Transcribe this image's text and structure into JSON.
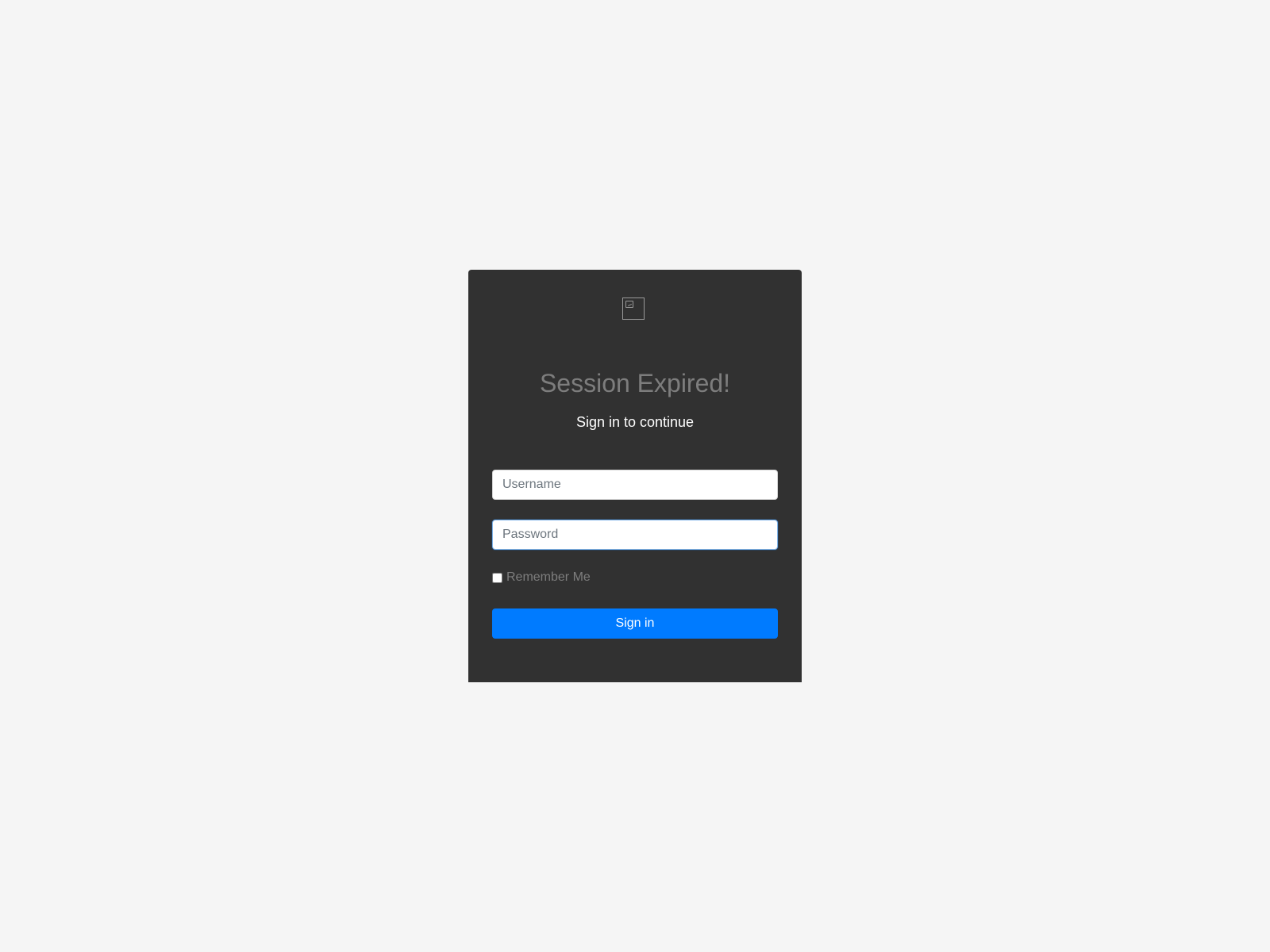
{
  "login": {
    "logo_icon": "broken-image-icon",
    "title": "Session Expired!",
    "subtitle": "Sign in to continue",
    "username_placeholder": "Username",
    "username_value": "",
    "password_placeholder": "Password",
    "password_value": "",
    "remember_me_label": "Remember Me",
    "remember_me_checked": false,
    "signin_label": "Sign in"
  },
  "colors": {
    "page_background": "#f5f5f5",
    "card_background": "#313131",
    "button_primary": "#007bff",
    "title_text": "#7d7d7d",
    "subtitle_text": "#ffffff",
    "focus_border": "#7fb3e8"
  }
}
